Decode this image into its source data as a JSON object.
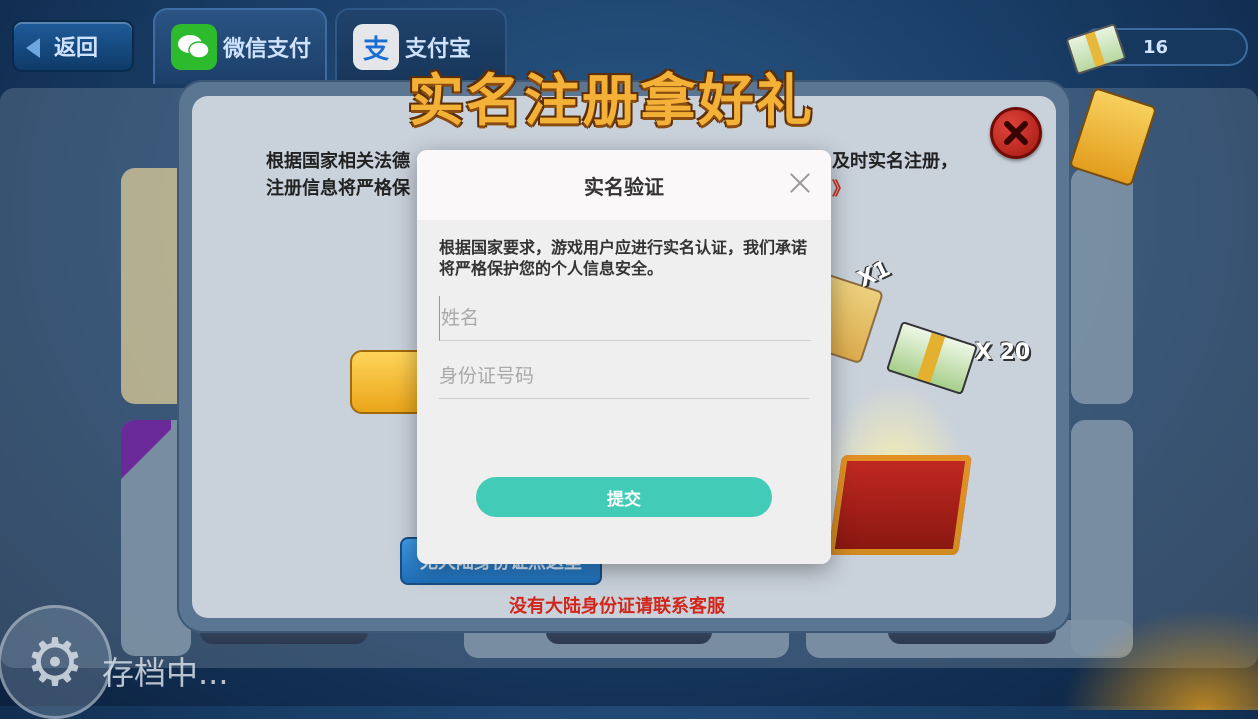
{
  "topbar": {
    "back_label": "返回",
    "tabs": [
      {
        "label": "微信支付",
        "icon": "wechat-icon"
      },
      {
        "label": "支付宝",
        "icon": "alipay-icon",
        "icon_glyph": "支"
      }
    ],
    "coin_count": "16"
  },
  "outer_dialog": {
    "title": "实名注册拿好礼",
    "notice_line1_left": "根据国家相关法德",
    "notice_line2_left": "注册信息将严格保",
    "notice_line1_right": "及时实名注册，",
    "notice_link_tail": "》",
    "blue_button_label": "无大陆身份证点这里",
    "footer_red_text": "没有大陆身份证请联系客服",
    "reward_ticket_multiplier": "X1",
    "reward_cash_multiplier": "X 20"
  },
  "modal": {
    "title": "实名验证",
    "description": "根据国家要求，游戏用户应进行实名认证，我们承诺将严格保护您的个人信息安全。",
    "name_field": {
      "placeholder": "姓名",
      "value": ""
    },
    "id_field": {
      "placeholder": "身份证号码",
      "value": ""
    },
    "submit_label": "提交"
  },
  "status": {
    "saving_text": "存档中..."
  },
  "colors": {
    "submit": "#42cbb6",
    "title_gold": "#f3b237",
    "warning_red": "#d3261a"
  }
}
